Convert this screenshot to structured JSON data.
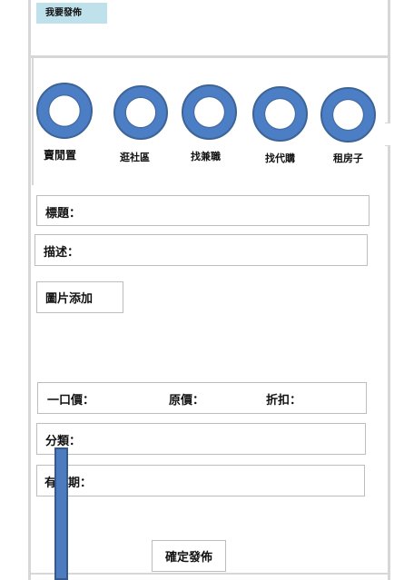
{
  "header": {
    "publish_label": "我要發佈"
  },
  "categories": [
    {
      "label": "賣閒置",
      "icon": "ring-icon"
    },
    {
      "label": "逛社區",
      "icon": "ring-icon"
    },
    {
      "label": "找兼職",
      "icon": "ring-icon"
    },
    {
      "label": "找代購",
      "icon": "ring-icon"
    },
    {
      "label": "租房子",
      "icon": "ring-icon"
    }
  ],
  "form": {
    "title_label": "標題：",
    "description_label": "描述：",
    "add_image_label": "圖片添加",
    "price_label": "一口價：",
    "original_price_label": "原價：",
    "discount_label": "折扣：",
    "category_label": "分類：",
    "validity_label": "有效期：",
    "submit_label": "確定發佈"
  },
  "colors": {
    "accent_light": "#bfe1ec",
    "icon_blue": "#4c7ec5",
    "border_gray": "#d7d7d7"
  }
}
